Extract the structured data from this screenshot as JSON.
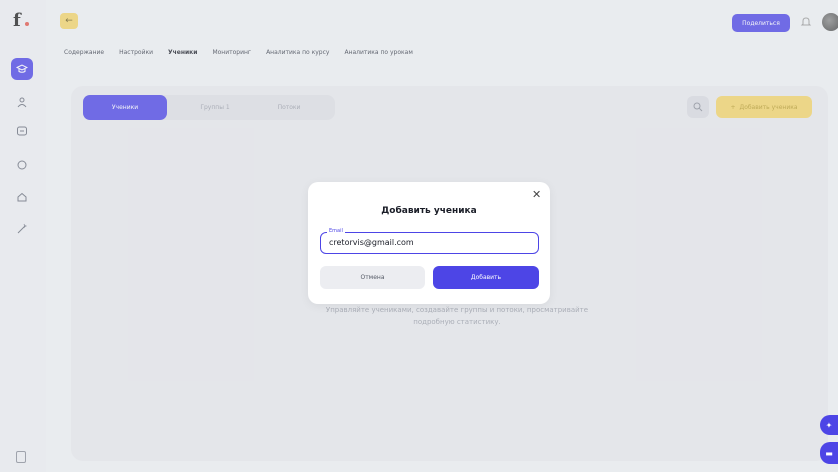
{
  "topbar": {
    "back_icon": "arrow-left-icon",
    "share_label": "Поделиться",
    "tabs": [
      {
        "label": "Содержание"
      },
      {
        "label": "Настройки"
      },
      {
        "label": "Ученики"
      },
      {
        "label": "Мониторинг"
      },
      {
        "label": "Аналитика по курсу"
      },
      {
        "label": "Аналитика по урокам"
      }
    ],
    "active_tab": "Ученики"
  },
  "sidebar": {
    "items": [
      {
        "icon": "graduation-cap-icon",
        "active": true
      },
      {
        "icon": "users-icon",
        "active": false
      },
      {
        "icon": "archive-icon",
        "active": false
      },
      {
        "icon": "chat-icon",
        "active": false
      },
      {
        "icon": "home-icon",
        "active": false
      },
      {
        "icon": "magic-wand-icon",
        "active": false
      }
    ]
  },
  "main": {
    "segments": [
      {
        "label": "Ученики",
        "active": true
      },
      {
        "label": "Группы 1",
        "active": false
      },
      {
        "label": "Потоки",
        "active": false
      }
    ],
    "add_student_label": "Добавить ученика",
    "hint_line1": "Управляйте учениками, создавайте группы и потоки, просматривайте",
    "hint_line2": "подробную статистику."
  },
  "modal": {
    "title": "Добавить ученика",
    "field_label": "Email",
    "field_value": "cretorvis@gmail.com",
    "cancel_label": "Отмена",
    "add_label": "Добавить"
  },
  "colors": {
    "accent": "#4d45e6",
    "yellow": "#f2d36a"
  }
}
